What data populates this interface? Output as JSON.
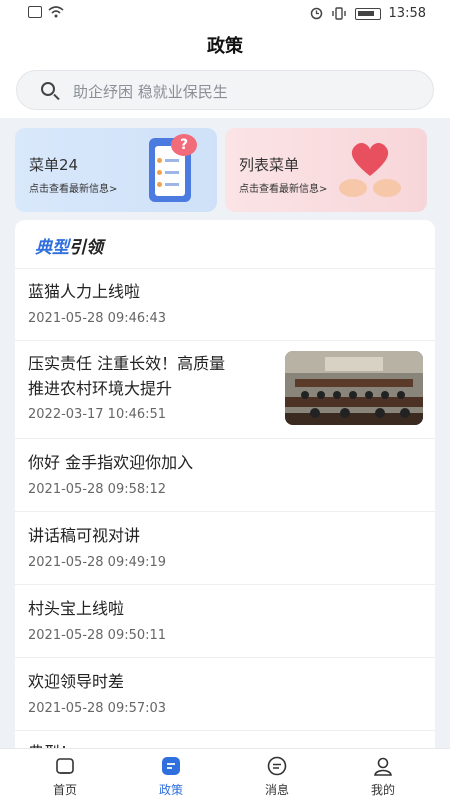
{
  "status_bar": {
    "time": "13:58"
  },
  "header": {
    "title": "政策"
  },
  "search": {
    "placeholder": "助企纾困 稳就业保民生"
  },
  "cards": [
    {
      "title": "菜单24",
      "subtitle": "点击查看最新信息>"
    },
    {
      "title": "列表菜单",
      "subtitle": "点击查看最新信息>"
    }
  ],
  "section": {
    "title_part1": "典型",
    "title_part2": "引领"
  },
  "items": [
    {
      "title": "蓝猫人力上线啦",
      "date": "2021-05-28 09:46:43"
    },
    {
      "title_line1": "压实责任 注重长效！高质量",
      "title_line2": "推进农村环境大提升",
      "date": "2022-03-17 10:46:51",
      "image": "meeting-room-photo"
    },
    {
      "title": "你好 金手指欢迎你加入",
      "date": "2021-05-28 09:58:12"
    },
    {
      "title": "讲话稿可视对讲",
      "date": "2021-05-28 09:49:19"
    },
    {
      "title": "村头宝上线啦",
      "date": "2021-05-28 09:50:11"
    },
    {
      "title": "欢迎领导时差",
      "date": "2021-05-28 09:57:03"
    },
    {
      "title": "典型！"
    }
  ],
  "tabbar": {
    "tabs": [
      {
        "label": "首页",
        "icon": "home-icon"
      },
      {
        "label": "政策",
        "icon": "policy-icon",
        "active": true
      },
      {
        "label": "消息",
        "icon": "message-icon"
      },
      {
        "label": "我的",
        "icon": "profile-icon"
      }
    ],
    "accent": "#2f6fde"
  }
}
